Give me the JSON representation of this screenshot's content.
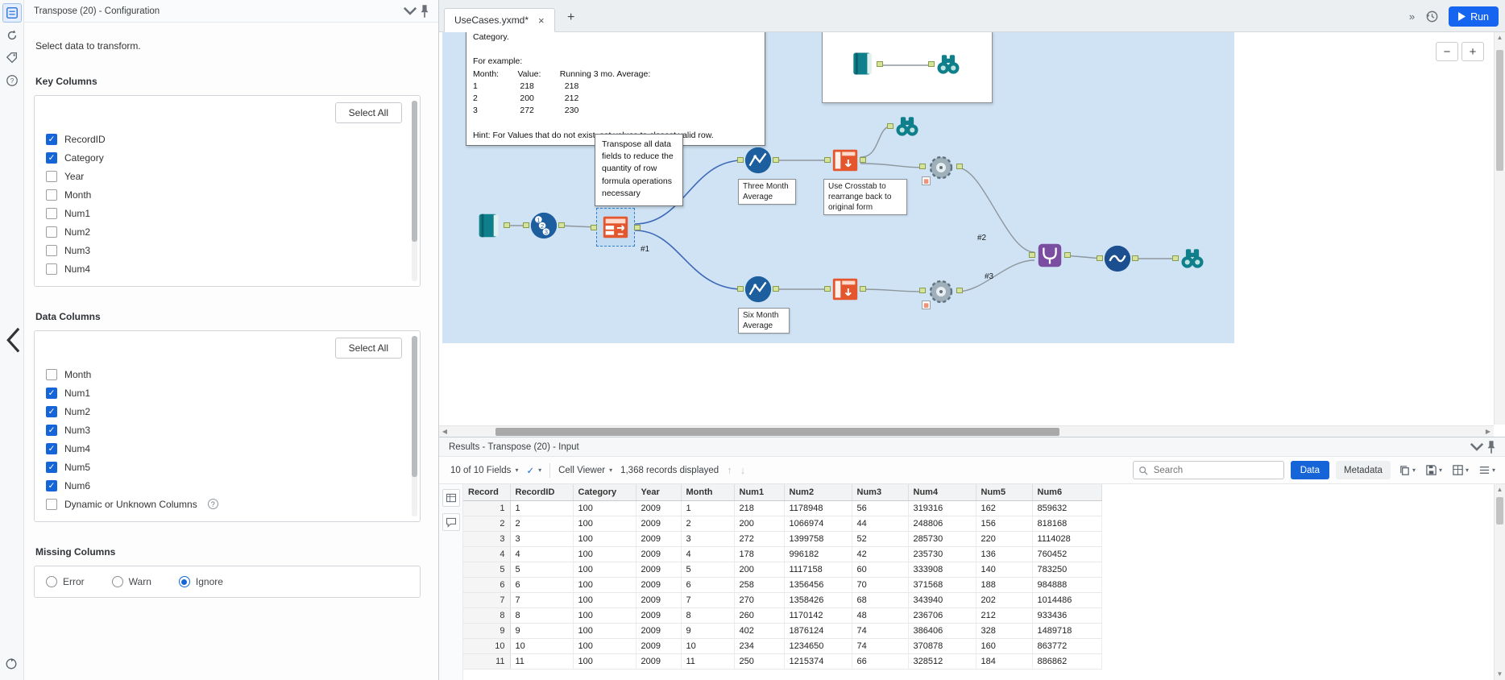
{
  "config_panel": {
    "title": "Transpose (20) - Configuration",
    "intro": "Select data to transform.",
    "key_columns": {
      "label": "Key Columns",
      "select_all": "Select All",
      "items": [
        {
          "label": "RecordID",
          "checked": true
        },
        {
          "label": "Category",
          "checked": true
        },
        {
          "label": "Year",
          "checked": false
        },
        {
          "label": "Month",
          "checked": false
        },
        {
          "label": "Num1",
          "checked": false
        },
        {
          "label": "Num2",
          "checked": false
        },
        {
          "label": "Num3",
          "checked": false
        },
        {
          "label": "Num4",
          "checked": false
        }
      ]
    },
    "data_columns": {
      "label": "Data Columns",
      "select_all": "Select All",
      "items": [
        {
          "label": "Month",
          "checked": false
        },
        {
          "label": "Num1",
          "checked": true
        },
        {
          "label": "Num2",
          "checked": true
        },
        {
          "label": "Num3",
          "checked": true
        },
        {
          "label": "Num4",
          "checked": true
        },
        {
          "label": "Num5",
          "checked": true
        },
        {
          "label": "Num6",
          "checked": true
        },
        {
          "label": "Dynamic or Unknown Columns",
          "checked": false,
          "help": true
        }
      ]
    },
    "missing_columns": {
      "label": "Missing Columns",
      "options": [
        {
          "label": "Error",
          "selected": false
        },
        {
          "label": "Warn",
          "selected": false
        },
        {
          "label": "Ignore",
          "selected": true
        }
      ]
    }
  },
  "tab_bar": {
    "active_tab": "UseCases.yxmd*",
    "run_label": "Run"
  },
  "canvas": {
    "top_comment": "Category.\n\nFor example:\nMonth:        Value:        Running 3 mo. Average:\n1                  218             218\n2                  200             212\n3                  272             230\n\nHint: For Values that do not exist, set values to closest valid row.",
    "transpose_note": "Transpose all data fields to reduce the quantity of row formula operations necessary",
    "crosstab_note": "Use Crosstab to rearrange back to original form",
    "three_month_caption": "Three Month Average",
    "six_month_caption": "Six Month Average",
    "labels": {
      "l1": "#1",
      "l2": "#2",
      "l3": "#3"
    }
  },
  "results": {
    "title": "Results - Transpose (20) - Input",
    "fields_summary": "10 of 10 Fields",
    "cell_viewer_label": "Cell Viewer",
    "records_displayed": "1,368 records displayed",
    "search_placeholder": "Search",
    "data_button": "Data",
    "metadata_button": "Metadata",
    "columns": [
      "Record",
      "RecordID",
      "Category",
      "Year",
      "Month",
      "Num1",
      "Num2",
      "Num3",
      "Num4",
      "Num5",
      "Num6"
    ],
    "rows": [
      [
        "1",
        "1",
        "100",
        "2009",
        "1",
        "218",
        "1178948",
        "56",
        "319316",
        "162",
        "859632"
      ],
      [
        "2",
        "2",
        "100",
        "2009",
        "2",
        "200",
        "1066974",
        "44",
        "248806",
        "156",
        "818168"
      ],
      [
        "3",
        "3",
        "100",
        "2009",
        "3",
        "272",
        "1399758",
        "52",
        "285730",
        "220",
        "1114028"
      ],
      [
        "4",
        "4",
        "100",
        "2009",
        "4",
        "178",
        "996182",
        "42",
        "235730",
        "136",
        "760452"
      ],
      [
        "5",
        "5",
        "100",
        "2009",
        "5",
        "200",
        "1117158",
        "60",
        "333908",
        "140",
        "783250"
      ],
      [
        "6",
        "6",
        "100",
        "2009",
        "6",
        "258",
        "1356456",
        "70",
        "371568",
        "188",
        "984888"
      ],
      [
        "7",
        "7",
        "100",
        "2009",
        "7",
        "270",
        "1358426",
        "68",
        "343940",
        "202",
        "1014486"
      ],
      [
        "8",
        "8",
        "100",
        "2009",
        "8",
        "260",
        "1170142",
        "48",
        "236706",
        "212",
        "933436"
      ],
      [
        "9",
        "9",
        "100",
        "2009",
        "9",
        "402",
        "1876124",
        "74",
        "386406",
        "328",
        "1489718"
      ],
      [
        "10",
        "10",
        "100",
        "2009",
        "10",
        "234",
        "1234650",
        "74",
        "370878",
        "160",
        "863772"
      ],
      [
        "11",
        "11",
        "100",
        "2009",
        "11",
        "250",
        "1215374",
        "66",
        "328512",
        "184",
        "886862"
      ]
    ]
  }
}
